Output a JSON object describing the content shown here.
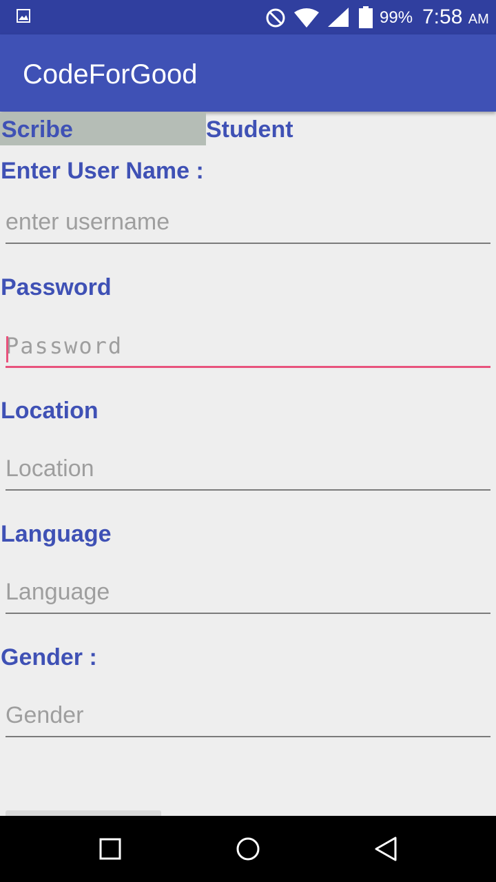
{
  "status_bar": {
    "battery_percent": "99%",
    "time": "7:58",
    "ampm": "AM",
    "icons": [
      "gallery-icon",
      "do-not-disturb-icon",
      "wifi-icon",
      "cell-signal-icon",
      "battery-icon"
    ]
  },
  "app_bar": {
    "title": "CodeForGood",
    "color": "#3f51b5"
  },
  "tabs": [
    {
      "label": "Scribe",
      "selected": true
    },
    {
      "label": "Student",
      "selected": false
    }
  ],
  "form": {
    "username": {
      "label": "Enter User Name :",
      "placeholder": "enter username"
    },
    "password": {
      "label": "Password",
      "placeholder": "Password"
    },
    "location": {
      "label": "Location",
      "placeholder": "Location"
    },
    "language": {
      "label": "Language",
      "placeholder": "Language"
    },
    "gender": {
      "label": "Gender :",
      "placeholder": "Gender"
    }
  },
  "nav_bar": {
    "buttons": [
      "recent-apps",
      "home",
      "back"
    ]
  },
  "colors": {
    "accent": "#e8527c",
    "primary_dark": "#303f9f"
  }
}
